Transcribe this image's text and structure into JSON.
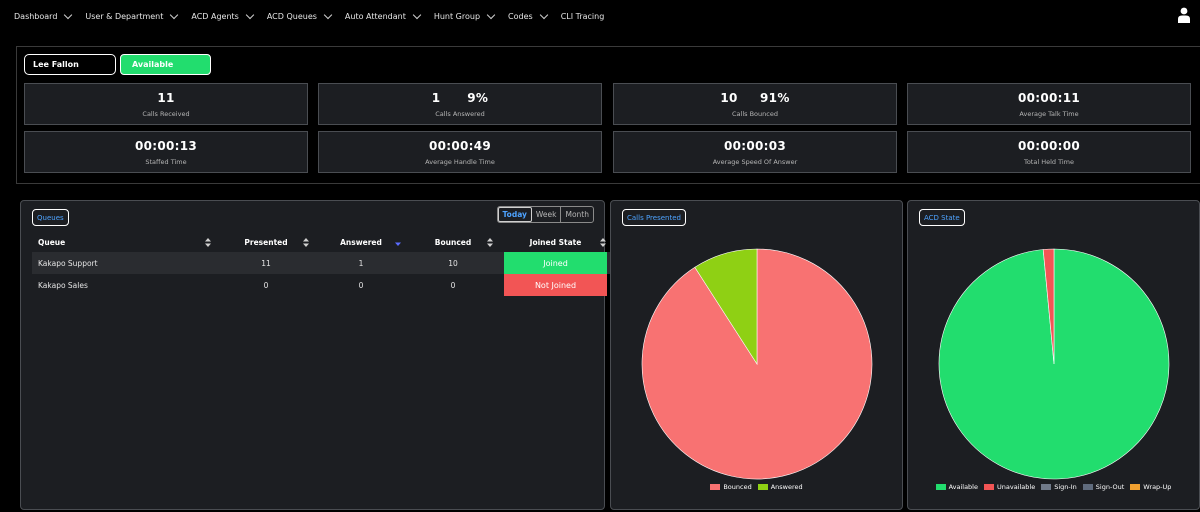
{
  "nav": {
    "items": [
      {
        "label": "Dashboard",
        "dropdown": true
      },
      {
        "label": "User & Department",
        "dropdown": true
      },
      {
        "label": "ACD Agents",
        "dropdown": true
      },
      {
        "label": "ACD Queues",
        "dropdown": true
      },
      {
        "label": "Auto Attendant",
        "dropdown": true
      },
      {
        "label": "Hunt Group",
        "dropdown": true
      },
      {
        "label": "Codes",
        "dropdown": true
      },
      {
        "label": "CLI Tracing",
        "dropdown": false
      }
    ],
    "user_icon": "user-icon"
  },
  "agent": {
    "name": "Lee Fallon",
    "status": "Available",
    "status_color": "#22dd6e"
  },
  "stats": [
    {
      "value": "11",
      "label": "Calls Received"
    },
    {
      "value": "1      9%",
      "label": "Calls Answered"
    },
    {
      "value": "10     91%",
      "label": "Calls Bounced"
    },
    {
      "value": "00:00:11",
      "label": "Average Talk Time"
    },
    {
      "value": "00:00:13",
      "label": "Staffed Time"
    },
    {
      "value": "00:00:49",
      "label": "Average Handle Time"
    },
    {
      "value": "00:00:03",
      "label": "Average Speed Of Answer"
    },
    {
      "value": "00:00:00",
      "label": "Total Held Time"
    }
  ],
  "queues": {
    "title": "Queues",
    "range": {
      "options": [
        "Today",
        "Week",
        "Month"
      ],
      "selected": "Today"
    },
    "columns": [
      "Queue",
      "Presented",
      "Answered",
      "Bounced",
      "Joined State"
    ],
    "rows": [
      {
        "queue": "Kakapo Support",
        "presented": "11",
        "answered": "1",
        "bounced": "10",
        "state": "Joined",
        "state_color": "#22dd6e"
      },
      {
        "queue": "Kakapo Sales",
        "presented": "0",
        "answered": "0",
        "bounced": "0",
        "state": "Not Joined",
        "state_color": "#f25555"
      }
    ]
  },
  "calls_presented": {
    "title": "Calls Presented",
    "chart_data": {
      "type": "pie",
      "categories": [
        "Bounced",
        "Answered"
      ],
      "values": [
        10,
        1
      ],
      "colors": [
        "#f87272",
        "#8fd014"
      ],
      "legend": "bottom"
    }
  },
  "acd_state": {
    "title": "ACD State",
    "chart_data": {
      "type": "pie",
      "categories": [
        "Available",
        "Unavailable",
        "Sign-In",
        "Sign-Out",
        "Wrap-Up"
      ],
      "values": [
        98.5,
        1.5,
        0,
        0,
        0
      ],
      "colors": [
        "#22dd6e",
        "#f25555",
        "#707a89",
        "#5f6b7d",
        "#f0a030"
      ],
      "legend": "bottom"
    }
  }
}
